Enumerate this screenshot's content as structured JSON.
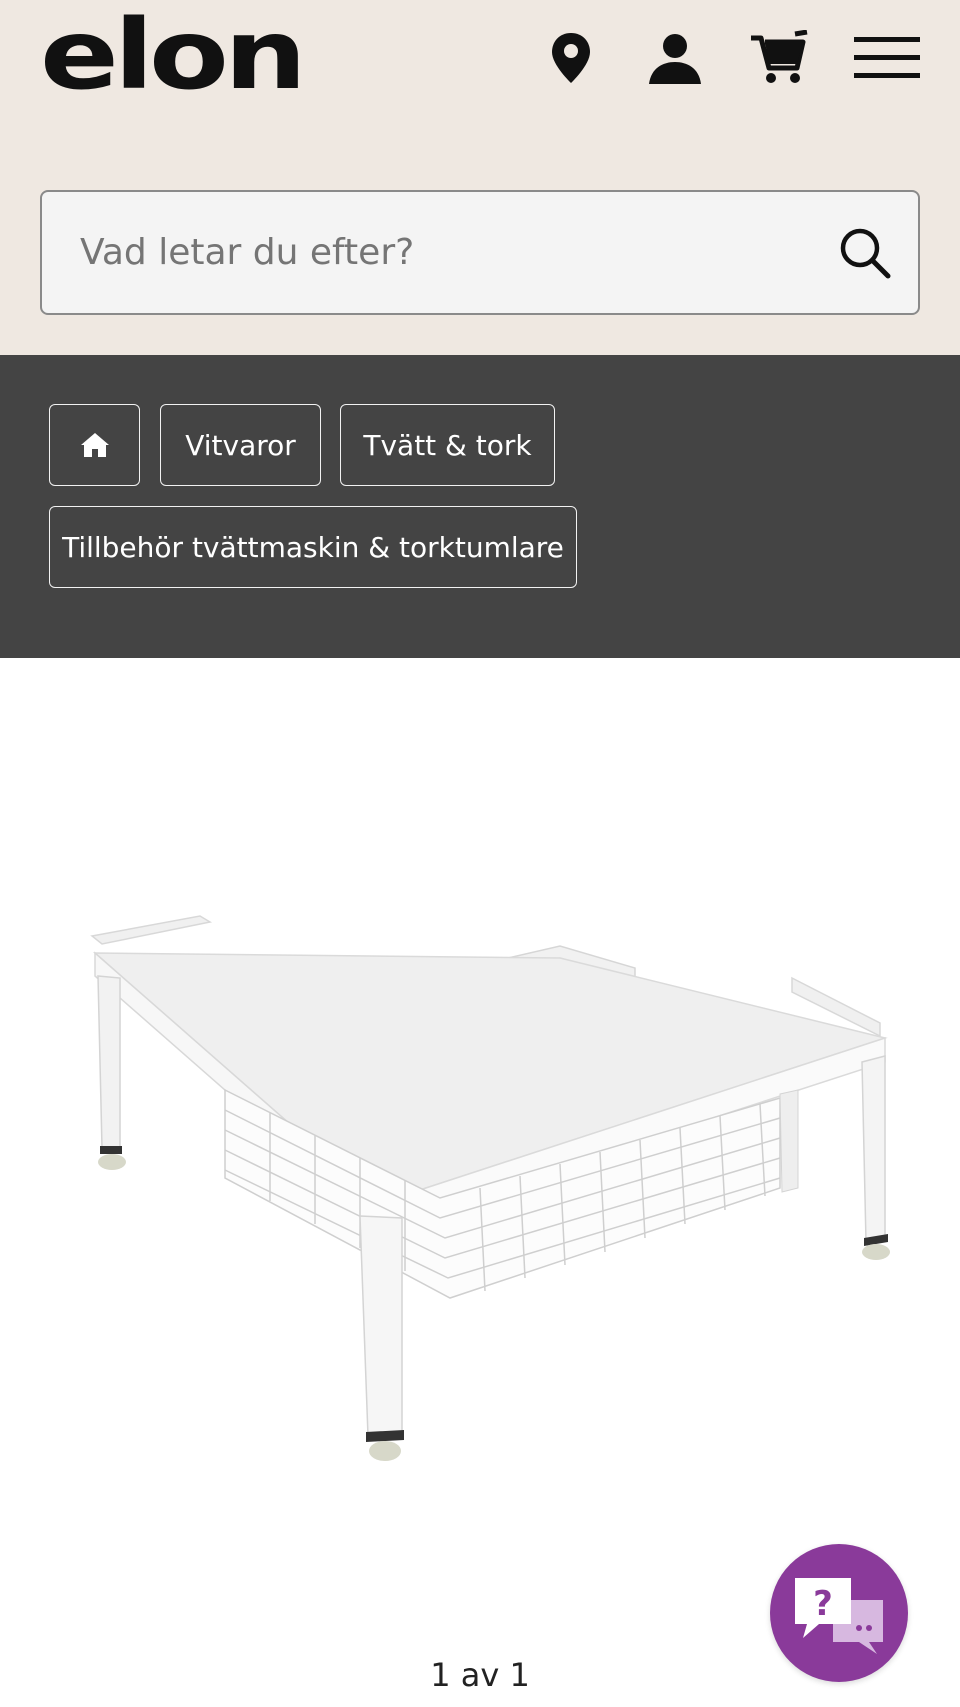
{
  "header": {
    "logo_text": "elon",
    "icons": [
      "location-pin-icon",
      "user-icon",
      "cart-icon",
      "menu-icon"
    ],
    "background": "#efe8e1"
  },
  "search": {
    "placeholder": "Vad letar du efter?",
    "icon": "search-icon"
  },
  "breadcrumbs": {
    "background": "#444444",
    "home_icon": "home-icon",
    "items": [
      "Vitvaror",
      "Tvätt & tork",
      "Tillbehör tvättmaskin & torktumlare"
    ]
  },
  "gallery": {
    "image": "washer-stand-with-basket",
    "pager": "1 av 1"
  },
  "chat": {
    "icon": "help-chat-icon",
    "color": "#8a3a9a"
  }
}
